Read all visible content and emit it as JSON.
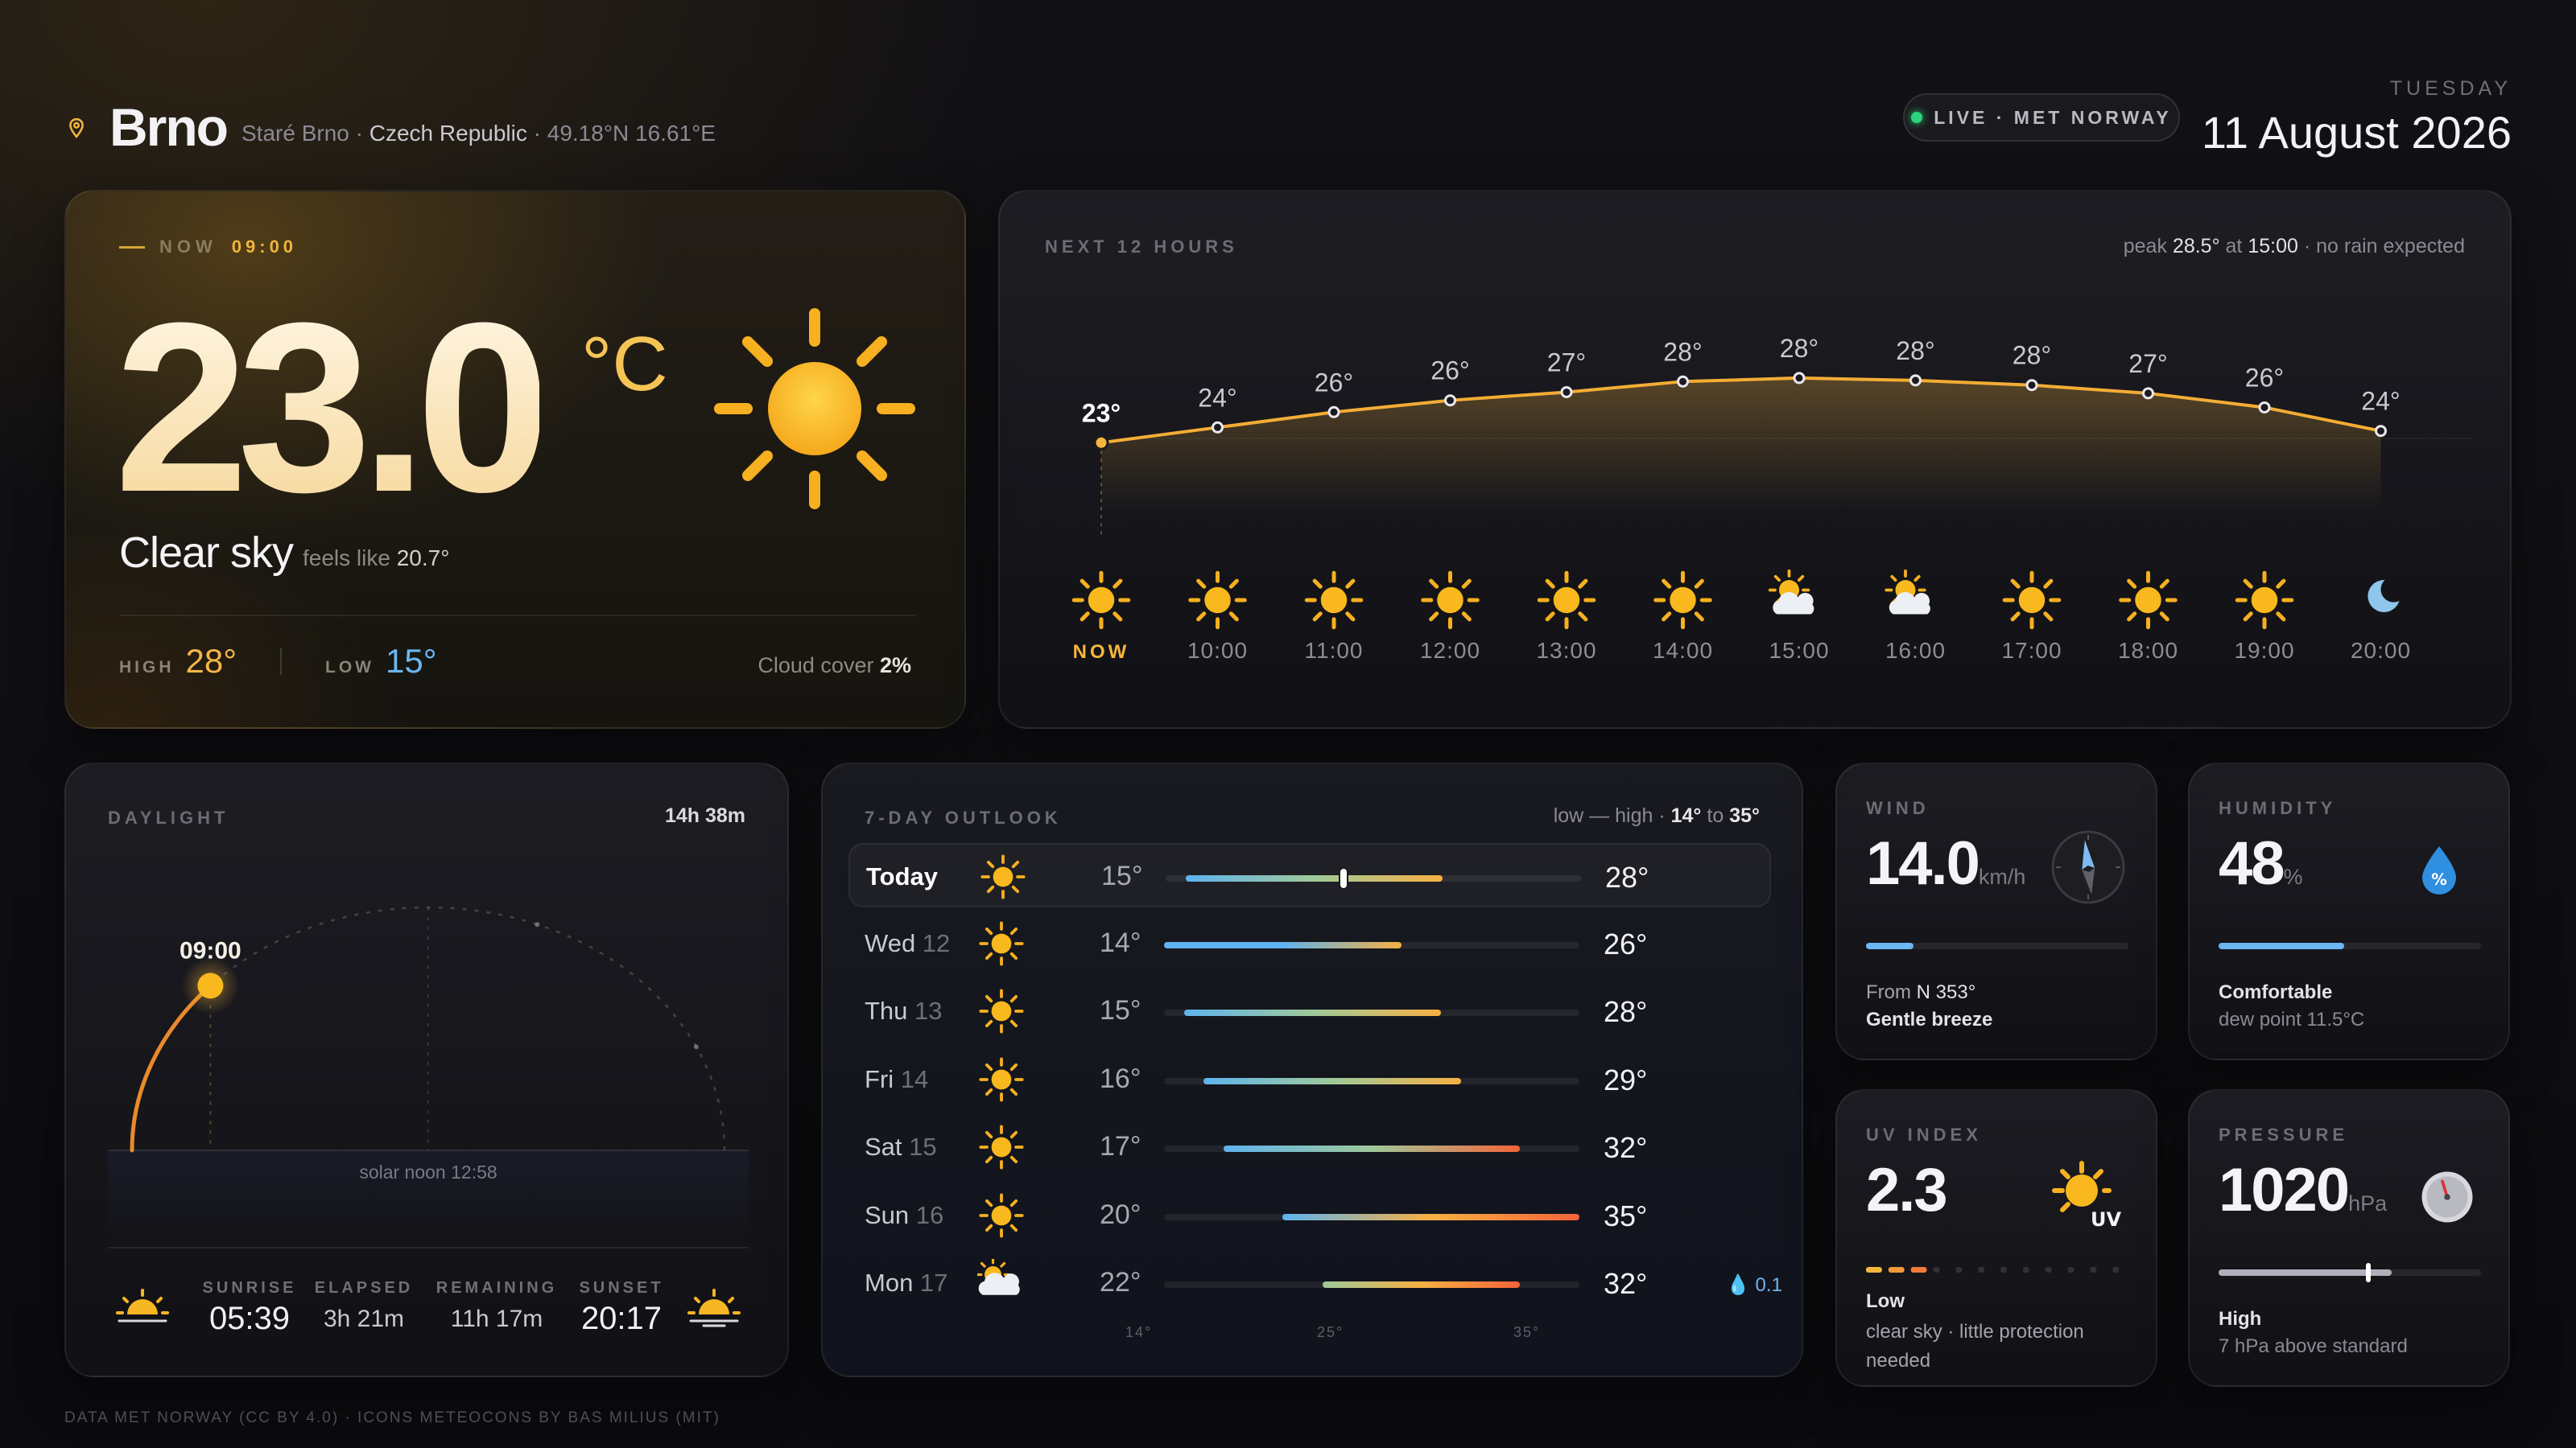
{
  "header": {
    "city": "Brno",
    "district": "Staré Brno",
    "country": "Czech Republic",
    "coords": "49.18°N 16.61°E",
    "live_label": "LIVE · MET NORWAY",
    "weekday": "TUESDAY",
    "date": "11 August 2026"
  },
  "now": {
    "label": "NOW",
    "time": "09:00",
    "temp": "23.0",
    "unit": "°C",
    "condition": "Clear sky",
    "feels_label": "feels like",
    "feels_value": "20.7°",
    "high_label": "HIGH",
    "high": "28°",
    "low_label": "LOW",
    "low": "15°",
    "cloud_label": "Cloud cover",
    "cloud_value": "2%",
    "icon": "sun-icon"
  },
  "hourly": {
    "title": "NEXT 12 HOURS",
    "peak_prefix": "peak",
    "peak_value": "28.5°",
    "peak_at": "at",
    "peak_time": "15:00",
    "peak_sep": "·",
    "rain_note": "no rain expected",
    "hours": [
      {
        "time": "NOW",
        "temp": 23.0,
        "label": "23°",
        "icon": "sun"
      },
      {
        "time": "10:00",
        "temp": 24.3,
        "label": "24°",
        "icon": "sun"
      },
      {
        "time": "11:00",
        "temp": 25.6,
        "label": "26°",
        "icon": "sun"
      },
      {
        "time": "12:00",
        "temp": 26.6,
        "label": "26°",
        "icon": "sun"
      },
      {
        "time": "13:00",
        "temp": 27.3,
        "label": "27°",
        "icon": "sun"
      },
      {
        "time": "14:00",
        "temp": 28.2,
        "label": "28°",
        "icon": "sun"
      },
      {
        "time": "15:00",
        "temp": 28.5,
        "label": "28°",
        "icon": "partly-cloudy"
      },
      {
        "time": "16:00",
        "temp": 28.3,
        "label": "28°",
        "icon": "partly-cloudy"
      },
      {
        "time": "17:00",
        "temp": 27.9,
        "label": "28°",
        "icon": "sun"
      },
      {
        "time": "18:00",
        "temp": 27.2,
        "label": "27°",
        "icon": "sun"
      },
      {
        "time": "19:00",
        "temp": 26.0,
        "label": "26°",
        "icon": "sun"
      },
      {
        "time": "20:00",
        "temp": 24.0,
        "label": "24°",
        "icon": "moon"
      }
    ]
  },
  "daylight": {
    "title": "DAYLIGHT",
    "length": "14h 38m",
    "current_time": "09:00",
    "solar_noon": "solar noon 12:58",
    "progress": 0.237,
    "sunrise_label": "SUNRISE",
    "sunrise": "05:39",
    "elapsed_label": "ELAPSED",
    "elapsed": "3h 21m",
    "remaining_label": "REMAINING",
    "remaining": "11h 17m",
    "sunset_label": "SUNSET",
    "sunset": "20:17"
  },
  "week": {
    "title": "7-DAY OUTLOOK",
    "range_prefix": "low — high ·",
    "range_low": "14°",
    "range_to": "to",
    "range_high": "35°",
    "axis_min": 14,
    "axis_max": 35,
    "axis_ticks": [
      "14°",
      "25°",
      "35°"
    ],
    "days": [
      {
        "day": "Today",
        "date": "",
        "low": 15,
        "high": 28,
        "lo_label": "15°",
        "hi_label": "28°",
        "icon": "sun",
        "rain": "",
        "current": 23
      },
      {
        "day": "Wed",
        "date": "12",
        "low": 14,
        "high": 26,
        "lo_label": "14°",
        "hi_label": "26°",
        "icon": "sun",
        "rain": ""
      },
      {
        "day": "Thu",
        "date": "13",
        "low": 15,
        "high": 28,
        "lo_label": "15°",
        "hi_label": "28°",
        "icon": "sun",
        "rain": ""
      },
      {
        "day": "Fri",
        "date": "14",
        "low": 16,
        "high": 29,
        "lo_label": "16°",
        "hi_label": "29°",
        "icon": "sun",
        "rain": ""
      },
      {
        "day": "Sat",
        "date": "15",
        "low": 17,
        "high": 32,
        "lo_label": "17°",
        "hi_label": "32°",
        "icon": "sun",
        "rain": ""
      },
      {
        "day": "Sun",
        "date": "16",
        "low": 20,
        "high": 35,
        "lo_label": "20°",
        "hi_label": "35°",
        "icon": "sun",
        "rain": ""
      },
      {
        "day": "Mon",
        "date": "17",
        "low": 22,
        "high": 32,
        "lo_label": "22°",
        "hi_label": "32°",
        "icon": "partly-cloudy",
        "rain": "0.1"
      }
    ]
  },
  "wind": {
    "title": "WIND",
    "value": "14.0",
    "unit": "km/h",
    "from_label": "From",
    "direction": "N 353°",
    "desc": "Gentle breeze",
    "bar_fraction": 0.18,
    "bearing": 353,
    "icon": "compass-icon"
  },
  "humidity": {
    "title": "HUMIDITY",
    "value": "48",
    "unit": "%",
    "desc": "Comfortable",
    "dew": "dew point 11.5°C",
    "bar_fraction": 0.48,
    "icon": "humidity-drop-icon"
  },
  "uv": {
    "title": "UV INDEX",
    "value": "2.3",
    "level": "Low",
    "desc": "clear sky · little protection needed",
    "segments_total": 12,
    "segments_on": 2.3,
    "icon": "uv-sun-icon"
  },
  "pressure": {
    "title": "PRESSURE",
    "value": "1020",
    "unit": "hPa",
    "level": "High",
    "desc": "7 hPa above standard",
    "bar_fraction": 0.66,
    "marker_fraction": 0.56,
    "icon": "barometer-icon"
  },
  "footer": "DATA MET NORWAY (CC BY 4.0) · ICONS METEOCONS BY BAS MILIUS (MIT)",
  "colors": {
    "accent": "#f6b73c",
    "cool": "#6cb6f2",
    "warm": "#f39a3a",
    "hot": "#f2643a"
  }
}
